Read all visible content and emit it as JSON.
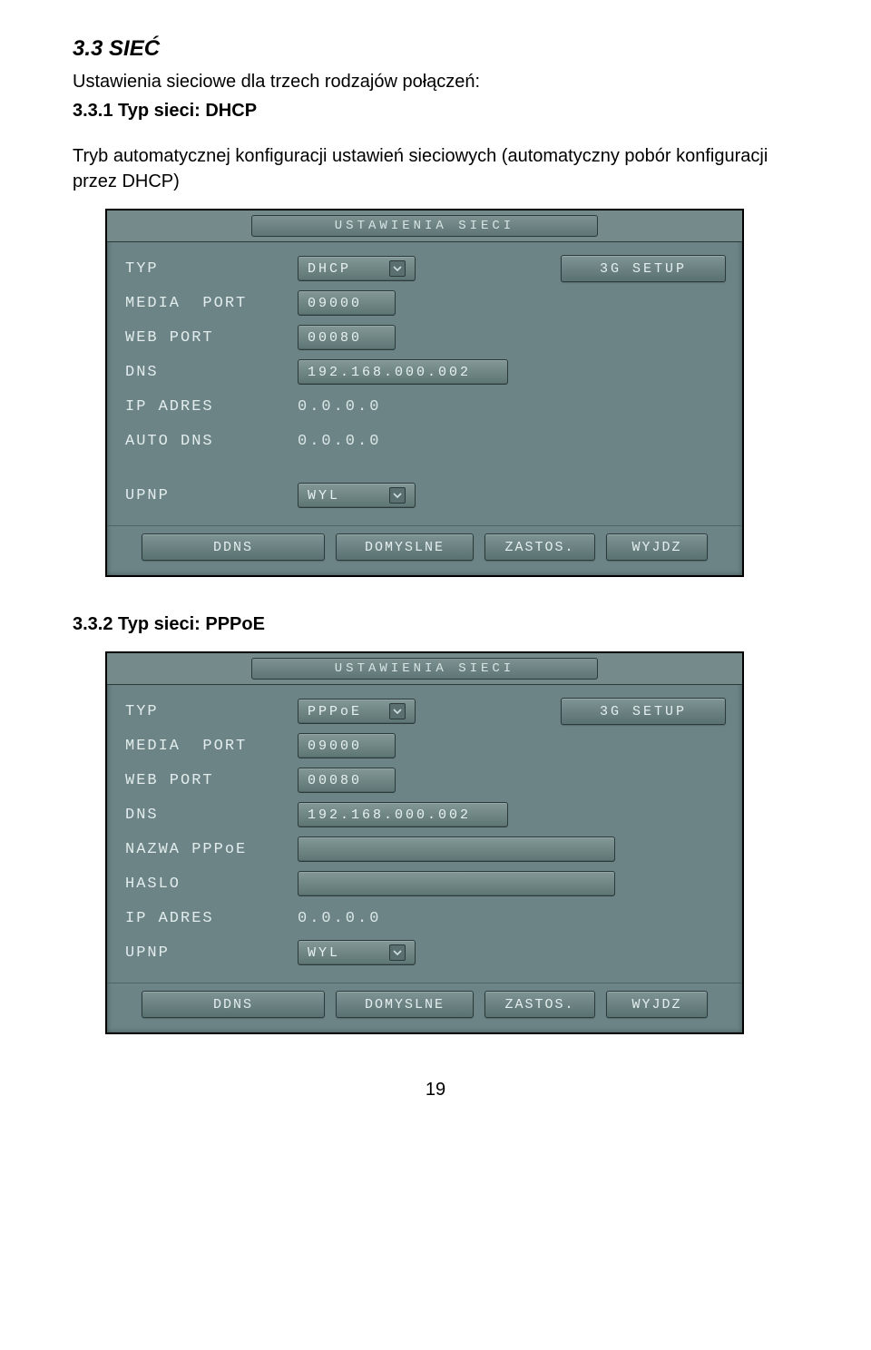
{
  "doc": {
    "section_title": "3.3 SIEĆ",
    "intro": "Ustawienia sieciowe dla trzech rodzajów połączeń:",
    "sub1_title": "3.3.1 Typ sieci: DHCP",
    "sub1_desc": "Tryb automatycznej konfiguracji ustawień sieciowych (automatyczny pobór konfiguracji przez DHCP)",
    "sub2_title": "3.3.2 Typ sieci: PPPoE",
    "page_number": "19"
  },
  "common": {
    "panel_title": "USTAWIENIA SIECI",
    "btn_3g": "3G SETUP",
    "btn_ddns": "DDNS",
    "btn_domyslne": "DOMYSLNE",
    "btn_zastos": "ZASTOS.",
    "btn_wyjdz": "WYJDZ",
    "labels": {
      "typ": "TYP",
      "media_port": "MEDIA  PORT",
      "web_port": "WEB PORT",
      "dns": "DNS",
      "ip_adres": "IP ADRES",
      "auto_dns": "AUTO DNS",
      "upnp": "UPNP",
      "nazwa_pppoe": "NAZWA PPPoE",
      "haslo": "HASLO"
    }
  },
  "panel1": {
    "typ": "DHCP",
    "media_port": "09000",
    "web_port": "00080",
    "dns": "192.168.000.002",
    "ip_adres": "0.0.0.0",
    "auto_dns": "0.0.0.0",
    "upnp": "WYL"
  },
  "panel2": {
    "typ": "PPPoE",
    "media_port": "09000",
    "web_port": "00080",
    "dns": "192.168.000.002",
    "nazwa_pppoe": "",
    "haslo": "",
    "ip_adres": "0.0.0.0",
    "upnp": "WYL"
  }
}
